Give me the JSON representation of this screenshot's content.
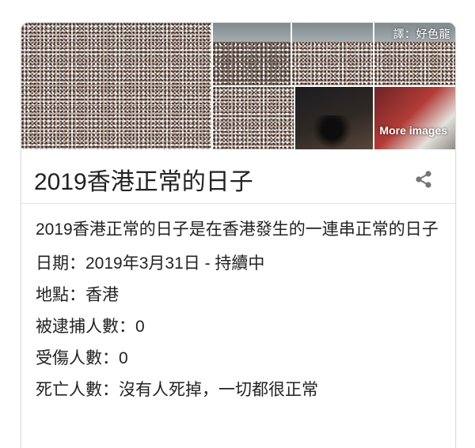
{
  "images": {
    "watermark": "譯：好色龍",
    "more_images_label": "More images"
  },
  "title": "2019香港正常的日子",
  "share_icon": "share-icon",
  "description": "2019香港正常的日子是在香港發生的一連串正常的日子",
  "facts": [
    {
      "label": "日期",
      "value": "2019年3月31日 - 持續中"
    },
    {
      "label": "地點",
      "value": "香港"
    },
    {
      "label": "被逮捕人數",
      "value": "0"
    },
    {
      "label": "受傷人數",
      "value": "0"
    },
    {
      "label": "死亡人數",
      "value": "沒有人死掉，一切都很正常"
    }
  ],
  "separator": "：",
  "colors": {
    "text": "#222222",
    "border": "#dcdcdc",
    "icon": "#757575"
  }
}
